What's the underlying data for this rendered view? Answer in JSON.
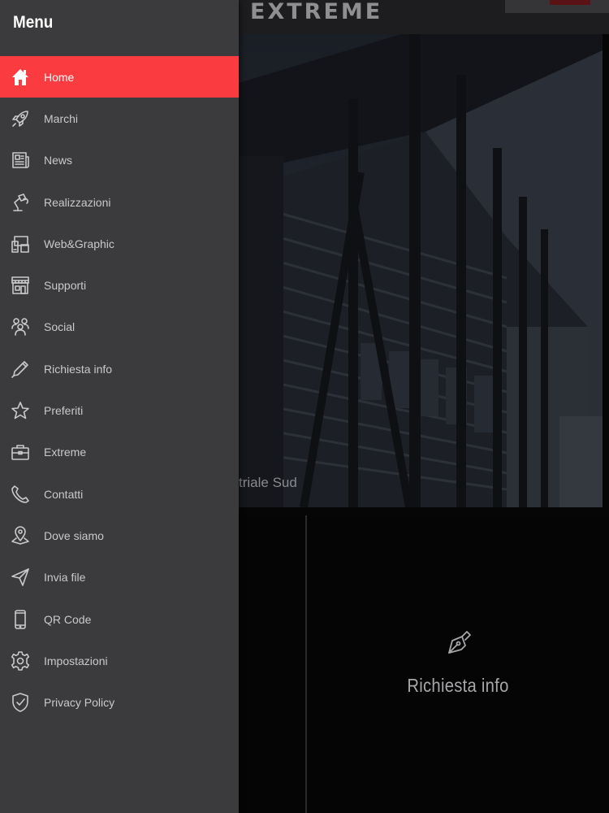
{
  "app": {
    "brand": "EXTREME"
  },
  "menu": {
    "title": "Menu",
    "active_color": "#fa3c41",
    "items": [
      {
        "label": "Home",
        "icon": "home-icon",
        "active": true
      },
      {
        "label": "Marchi",
        "icon": "rocket-icon",
        "active": false
      },
      {
        "label": "News",
        "icon": "newspaper-icon",
        "active": false
      },
      {
        "label": "Realizzazioni",
        "icon": "desk-lamp-icon",
        "active": false
      },
      {
        "label": "Web&Graphic",
        "icon": "devices-icon",
        "active": false
      },
      {
        "label": "Supporti",
        "icon": "storefront-icon",
        "active": false
      },
      {
        "label": "Social",
        "icon": "people-icon",
        "active": false
      },
      {
        "label": "Richiesta info",
        "icon": "pencil-icon",
        "active": false
      },
      {
        "label": "Preferiti",
        "icon": "star-icon",
        "active": false
      },
      {
        "label": "Extreme",
        "icon": "briefcase-icon",
        "active": false
      },
      {
        "label": "Contatti",
        "icon": "phone-icon",
        "active": false
      },
      {
        "label": "Dove siamo",
        "icon": "map-pin-icon",
        "active": false
      },
      {
        "label": "Invia file",
        "icon": "send-icon",
        "active": false
      },
      {
        "label": "QR Code",
        "icon": "smartphone-icon",
        "active": false
      },
      {
        "label": "Impostazioni",
        "icon": "gear-icon",
        "active": false
      },
      {
        "label": "Privacy Policy",
        "icon": "shield-check-icon",
        "active": false
      }
    ]
  },
  "hero": {
    "caption": "triale Sud"
  },
  "tiles": {
    "richiesta_info": "Richiesta info"
  }
}
